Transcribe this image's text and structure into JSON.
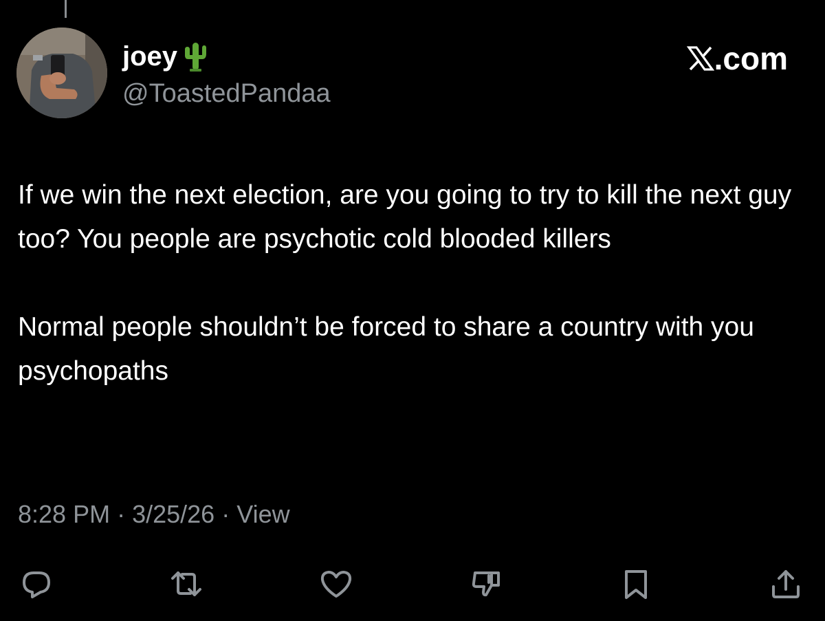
{
  "author": {
    "display_name": "joey",
    "emoji_icon": "cactus-icon",
    "handle": "@ToastedPandaa"
  },
  "brand": {
    "logo_icon": "x-logo-icon",
    "label": ".com"
  },
  "tweet": {
    "paragraphs": [
      "If we win the next election, are you going to try to kill the next guy too? You people are psychotic cold blooded killers",
      "Normal people shouldn’t be forced to share a country with you psychopaths"
    ]
  },
  "meta": {
    "time": "8:28 PM",
    "separator": "·",
    "date": "3/25/26",
    "views": "View"
  },
  "actions": [
    {
      "name": "reply-icon"
    },
    {
      "name": "retweet-icon"
    },
    {
      "name": "like-icon"
    },
    {
      "name": "dislike-icon"
    },
    {
      "name": "bookmark-icon"
    },
    {
      "name": "share-icon"
    }
  ],
  "colors": {
    "background": "#000000",
    "text": "#ffffff",
    "secondary_text": "#8f9499",
    "icon": "#8f9499"
  }
}
